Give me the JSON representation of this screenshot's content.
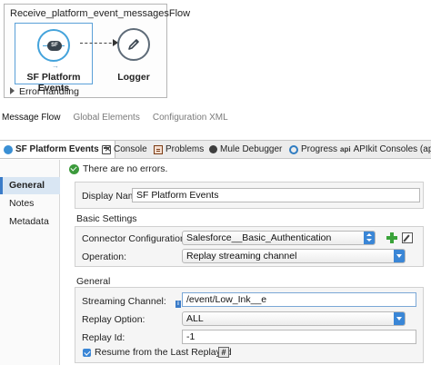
{
  "flow": {
    "title": "Receive_platform_event_messagesFlow",
    "source_label": "SF Platform Events",
    "source_icon_text": "SF",
    "logger_label": "Logger",
    "error_handling": "Error handling"
  },
  "editor_tabs": [
    "Message Flow",
    "Global Elements",
    "Configuration XML"
  ],
  "views": {
    "active": "SF Platform Events",
    "tabs": [
      "Console",
      "Problems",
      "Mule Debugger",
      "Progress",
      "APIkit Consoles (apsta"
    ],
    "apikit_icon": "api"
  },
  "nav": [
    "General",
    "Notes",
    "Metadata"
  ],
  "status": "There are no errors.",
  "display_name": {
    "label": "Display Name:",
    "value": "SF Platform Events"
  },
  "basic_settings": {
    "title": "Basic Settings",
    "connector_label": "Connector Configuration:",
    "connector_value": "Salesforce__Basic_Authentication",
    "operation_label": "Operation:",
    "operation_value": "Replay streaming channel"
  },
  "general": {
    "title": "General",
    "channel_label": "Streaming Channel:",
    "channel_value": "/event/Low_Ink__e",
    "replay_option_label": "Replay Option:",
    "replay_option_value": "ALL",
    "replay_id_label": "Replay Id:",
    "replay_id_value": "-1",
    "resume_label": "Resume from the Last Replay Id",
    "resume_checked": true,
    "hash_button": "#"
  },
  "colors": {
    "accent": "#3a86d6",
    "success": "#3c9a3c",
    "add": "#3aa33a"
  }
}
